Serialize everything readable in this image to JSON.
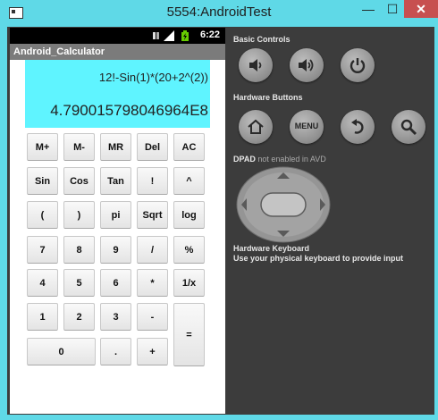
{
  "window": {
    "title": "5554:AndroidTest",
    "minimize_glyph": "—",
    "maximize_glyph": "☐",
    "close_glyph": "✕"
  },
  "phone": {
    "status_time": "6:22",
    "app_title": "Android_Calculator",
    "expression": "12!-Sin(1)*(20+2^(2))",
    "result": "4.790015798046964E8",
    "keys": {
      "m_plus": "M+",
      "m_minus": "M-",
      "mr": "MR",
      "del": "Del",
      "ac": "AC",
      "sin": "Sin",
      "cos": "Cos",
      "tan": "Tan",
      "fact": "!",
      "pow": "^",
      "lparen": "(",
      "rparen": ")",
      "pi": "pi",
      "sqrt": "Sqrt",
      "log": "log",
      "n7": "7",
      "n8": "8",
      "n9": "9",
      "div": "/",
      "pct": "%",
      "n4": "4",
      "n5": "5",
      "n6": "6",
      "mul": "*",
      "inv": "1/x",
      "n1": "1",
      "n2": "2",
      "n3": "3",
      "sub": "-",
      "eq": "=",
      "n0": "0",
      "dot": ".",
      "add": "+"
    }
  },
  "controls": {
    "basic_label": "Basic Controls",
    "hardware_label": "Hardware Buttons",
    "menu_label": "MENU",
    "dpad_label": "DPAD",
    "dpad_note": "not enabled in AVD",
    "keyboard_label": "Hardware Keyboard",
    "keyboard_note": "Use your physical keyboard to provide input"
  }
}
